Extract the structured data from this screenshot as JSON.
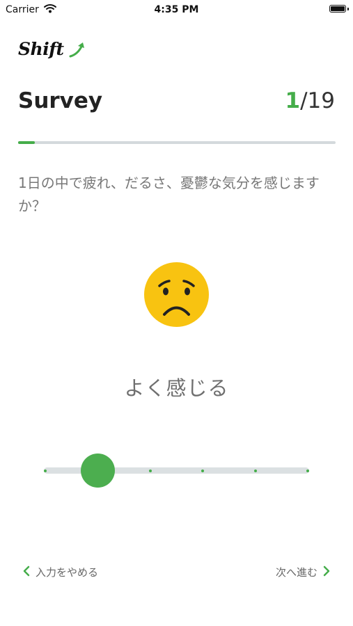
{
  "status_bar": {
    "carrier": "Carrier",
    "time": "4:35 PM",
    "icons": [
      "wifi-icon",
      "battery-icon"
    ]
  },
  "brand": {
    "logo_text": "Shift",
    "logo_icon": "up-arrow-icon",
    "accent_color": "#45ad4a"
  },
  "header": {
    "title": "Survey",
    "current": "1",
    "total": "/19"
  },
  "progress": {
    "current": 1,
    "total": 19
  },
  "question": {
    "text": "1日の中で疲れ、だるさ、憂鬱な気分を感じますか？"
  },
  "answer": {
    "face_icon": "sad-face-icon",
    "label": "よく感じる",
    "slider": {
      "steps": 6,
      "selected_index": 1
    }
  },
  "footer": {
    "back_label": "入力をやめる",
    "back_icon": "chevron-left-icon",
    "next_label": "次へ進む",
    "next_icon": "chevron-right-icon"
  }
}
